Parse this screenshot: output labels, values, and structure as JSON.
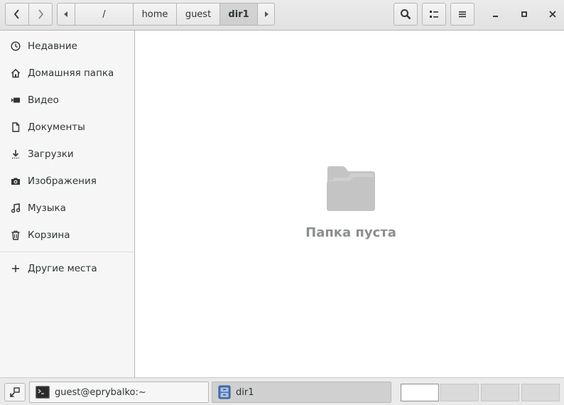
{
  "header": {
    "path": [
      "/",
      "home",
      "guest",
      "dir1"
    ],
    "active_segment": "dir1"
  },
  "sidebar": {
    "items": [
      {
        "label": "Недавние",
        "icon": "clock-icon"
      },
      {
        "label": "Домашняя папка",
        "icon": "home-icon"
      },
      {
        "label": "Видео",
        "icon": "video-icon"
      },
      {
        "label": "Документы",
        "icon": "document-icon"
      },
      {
        "label": "Загрузки",
        "icon": "download-icon"
      },
      {
        "label": "Изображения",
        "icon": "camera-icon"
      },
      {
        "label": "Музыка",
        "icon": "music-icon"
      },
      {
        "label": "Корзина",
        "icon": "trash-icon"
      }
    ],
    "other_places": {
      "label": "Другие места",
      "icon": "plus-icon"
    }
  },
  "main": {
    "empty_message": "Папка пуста",
    "empty_icon": "folder-icon"
  },
  "taskbar": {
    "tasks": [
      {
        "label": "guest@eprybalko:~",
        "icon": "terminal-icon",
        "active": false
      },
      {
        "label": "dir1",
        "icon": "file-manager-icon",
        "active": true
      }
    ],
    "workspaces": 4,
    "active_workspace": 1
  },
  "colors": {
    "sidebar_bg": "#f6f6f6",
    "main_bg": "#ffffff",
    "empty_text": "#8b8e8f"
  }
}
